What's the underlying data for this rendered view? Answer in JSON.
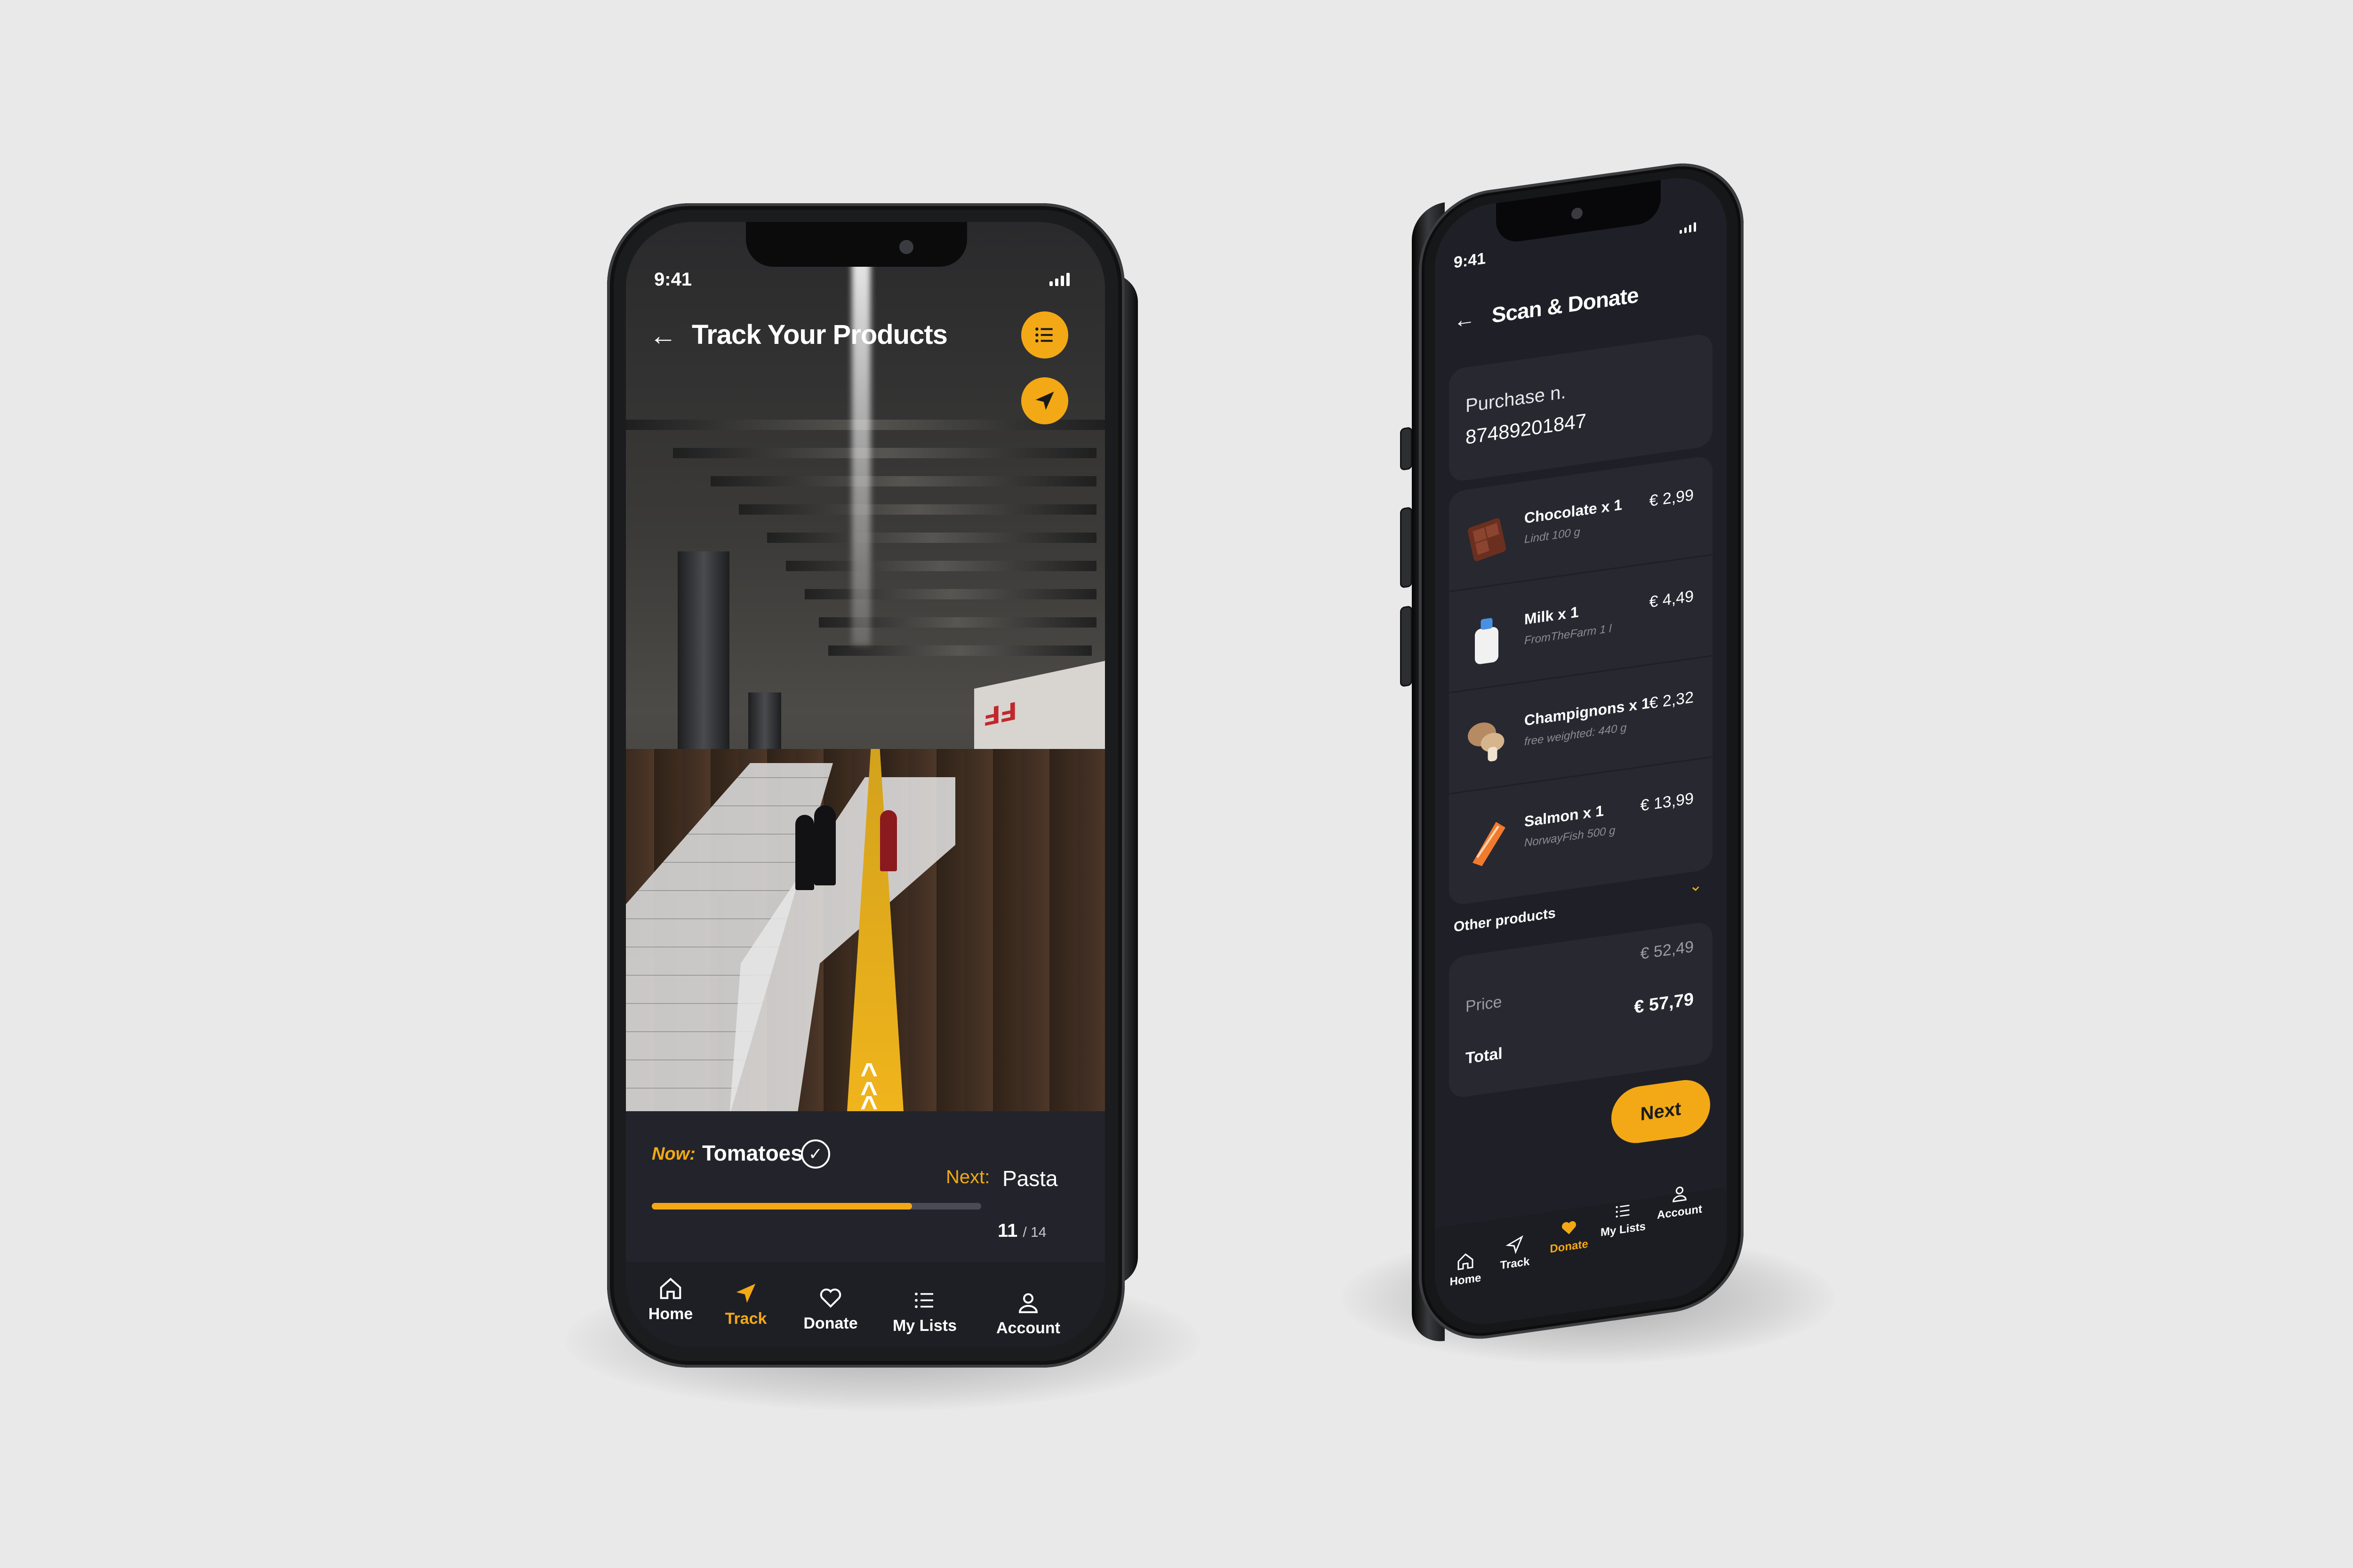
{
  "background_color": "#e9e9ea",
  "accent_color": "#f3a915",
  "phone_left": {
    "status_time": "9:41",
    "header": {
      "back_icon": "arrow-left-icon",
      "title": "Track Your Products",
      "list_button_icon": "list-icon",
      "navigate_button_icon": "navigation-arrow-icon"
    },
    "tracking": {
      "now_label": "Now:",
      "now_item": "Tomatoes",
      "next_label": "Next:",
      "next_item": "Pasta",
      "progress_fraction": 0.79,
      "current_count": "11",
      "total_count": "/ 14"
    },
    "nav": [
      {
        "label": "Home",
        "icon": "home-icon",
        "active": false
      },
      {
        "label": "Track",
        "icon": "navigation-arrow-icon",
        "active": true
      },
      {
        "label": "Donate",
        "icon": "heart-icon",
        "active": false
      },
      {
        "label": "My Lists",
        "icon": "list-icon",
        "active": false
      },
      {
        "label": "Account",
        "icon": "user-icon",
        "active": false
      }
    ]
  },
  "phone_right": {
    "status_time": "9:41",
    "header": {
      "back_icon": "arrow-left-icon",
      "title": "Scan & Donate"
    },
    "purchase": {
      "label": "Purchase n.",
      "number": "87489201847"
    },
    "items": [
      {
        "name": "Chocolate x 1",
        "detail": "Lindt 100 g",
        "price": "€ 2,99",
        "icon": "chocolate-icon"
      },
      {
        "name": "Milk x 1",
        "detail": "FromTheFarm 1 l",
        "price": "€ 4,49",
        "icon": "milk-bottle-icon"
      },
      {
        "name": "Champignons x 1",
        "detail": "free weighted: 440 g",
        "price": "€ 2,32",
        "icon": "mushroom-icon"
      },
      {
        "name": "Salmon x 1",
        "detail": "NorwayFish 500 g",
        "price": "€ 13,99",
        "icon": "salmon-icon"
      }
    ],
    "other_products": "Other products",
    "totals": {
      "price_label": "Price",
      "price_value": "€ 52,49",
      "total_label": "Total",
      "total_value": "€ 57,79"
    },
    "next_button": "Next",
    "nav": [
      {
        "label": "Home",
        "icon": "home-icon",
        "active": false
      },
      {
        "label": "Track",
        "icon": "navigation-arrow-icon",
        "active": false
      },
      {
        "label": "Donate",
        "icon": "heart-icon",
        "active": true
      },
      {
        "label": "My Lists",
        "icon": "list-icon",
        "active": false
      },
      {
        "label": "Account",
        "icon": "user-icon",
        "active": false
      }
    ]
  }
}
